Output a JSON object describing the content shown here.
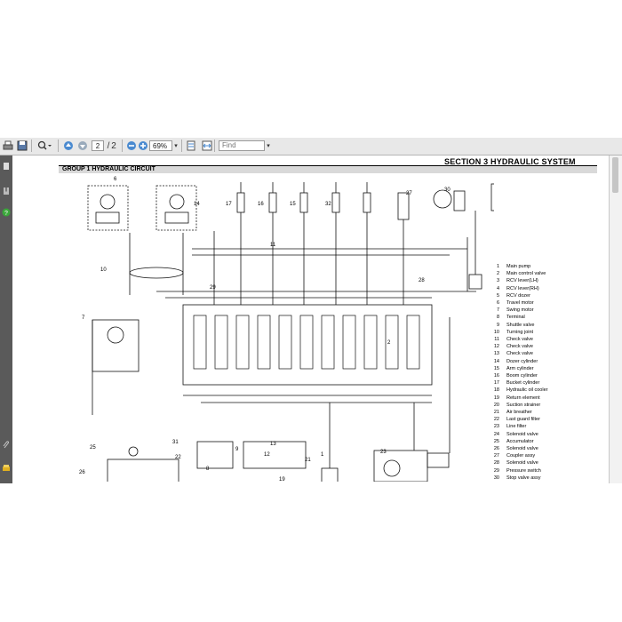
{
  "toolbar": {
    "page_current": "2",
    "page_separator": "/",
    "page_total": "2",
    "zoom": "69%",
    "find_placeholder": "Find"
  },
  "icons": [
    "print-icon",
    "save-icon",
    "search-icon",
    "nav-up-icon",
    "nav-down-icon",
    "zoom-out-icon",
    "zoom-in-icon",
    "fit-page-icon",
    "fit-width-icon"
  ],
  "document": {
    "section_title": "SECTION  3  HYDRAULIC SYSTEM",
    "group_title": "GROUP  1  HYDRAULIC CIRCUIT",
    "diagram_numbers": [
      "1",
      "2",
      "6",
      "7",
      "8",
      "9",
      "10",
      "11",
      "12",
      "13",
      "14",
      "15",
      "16",
      "17",
      "19",
      "20",
      "21",
      "22",
      "23",
      "25",
      "26",
      "27",
      "28",
      "29",
      "30",
      "31",
      "32"
    ],
    "legend": [
      {
        "n": "1",
        "label": "Main pump"
      },
      {
        "n": "2",
        "label": "Main control valve"
      },
      {
        "n": "3",
        "label": "RCV lever(LH)"
      },
      {
        "n": "4",
        "label": "RCV lever(RH)"
      },
      {
        "n": "5",
        "label": "RCV dozer"
      },
      {
        "n": "6",
        "label": "Travel motor"
      },
      {
        "n": "7",
        "label": "Swing motor"
      },
      {
        "n": "8",
        "label": "Terminal"
      },
      {
        "n": "9",
        "label": "Shuttle valve"
      },
      {
        "n": "10",
        "label": "Turning joint"
      },
      {
        "n": "11",
        "label": "Check valve"
      },
      {
        "n": "12",
        "label": "Check valve"
      },
      {
        "n": "13",
        "label": "Check valve"
      },
      {
        "n": "14",
        "label": "Dozer cylinder"
      },
      {
        "n": "15",
        "label": "Arm cylinder"
      },
      {
        "n": "16",
        "label": "Boom cylinder"
      },
      {
        "n": "17",
        "label": "Bucket cylinder"
      },
      {
        "n": "18",
        "label": "Hydraulic oil cooler"
      },
      {
        "n": "19",
        "label": "Return element"
      },
      {
        "n": "20",
        "label": "Suction strainer"
      },
      {
        "n": "21",
        "label": "Air breather"
      },
      {
        "n": "22",
        "label": "Last guard filter"
      },
      {
        "n": "23",
        "label": "Line filter"
      },
      {
        "n": "24",
        "label": "Solenoid valve"
      },
      {
        "n": "25",
        "label": "Accumulator"
      },
      {
        "n": "26",
        "label": "Solenoid valve"
      },
      {
        "n": "27",
        "label": "Coupler assy"
      },
      {
        "n": "28",
        "label": "Solenoid valve"
      },
      {
        "n": "29",
        "label": "Pressure switch"
      },
      {
        "n": "30",
        "label": "Stop valve assy"
      }
    ]
  }
}
